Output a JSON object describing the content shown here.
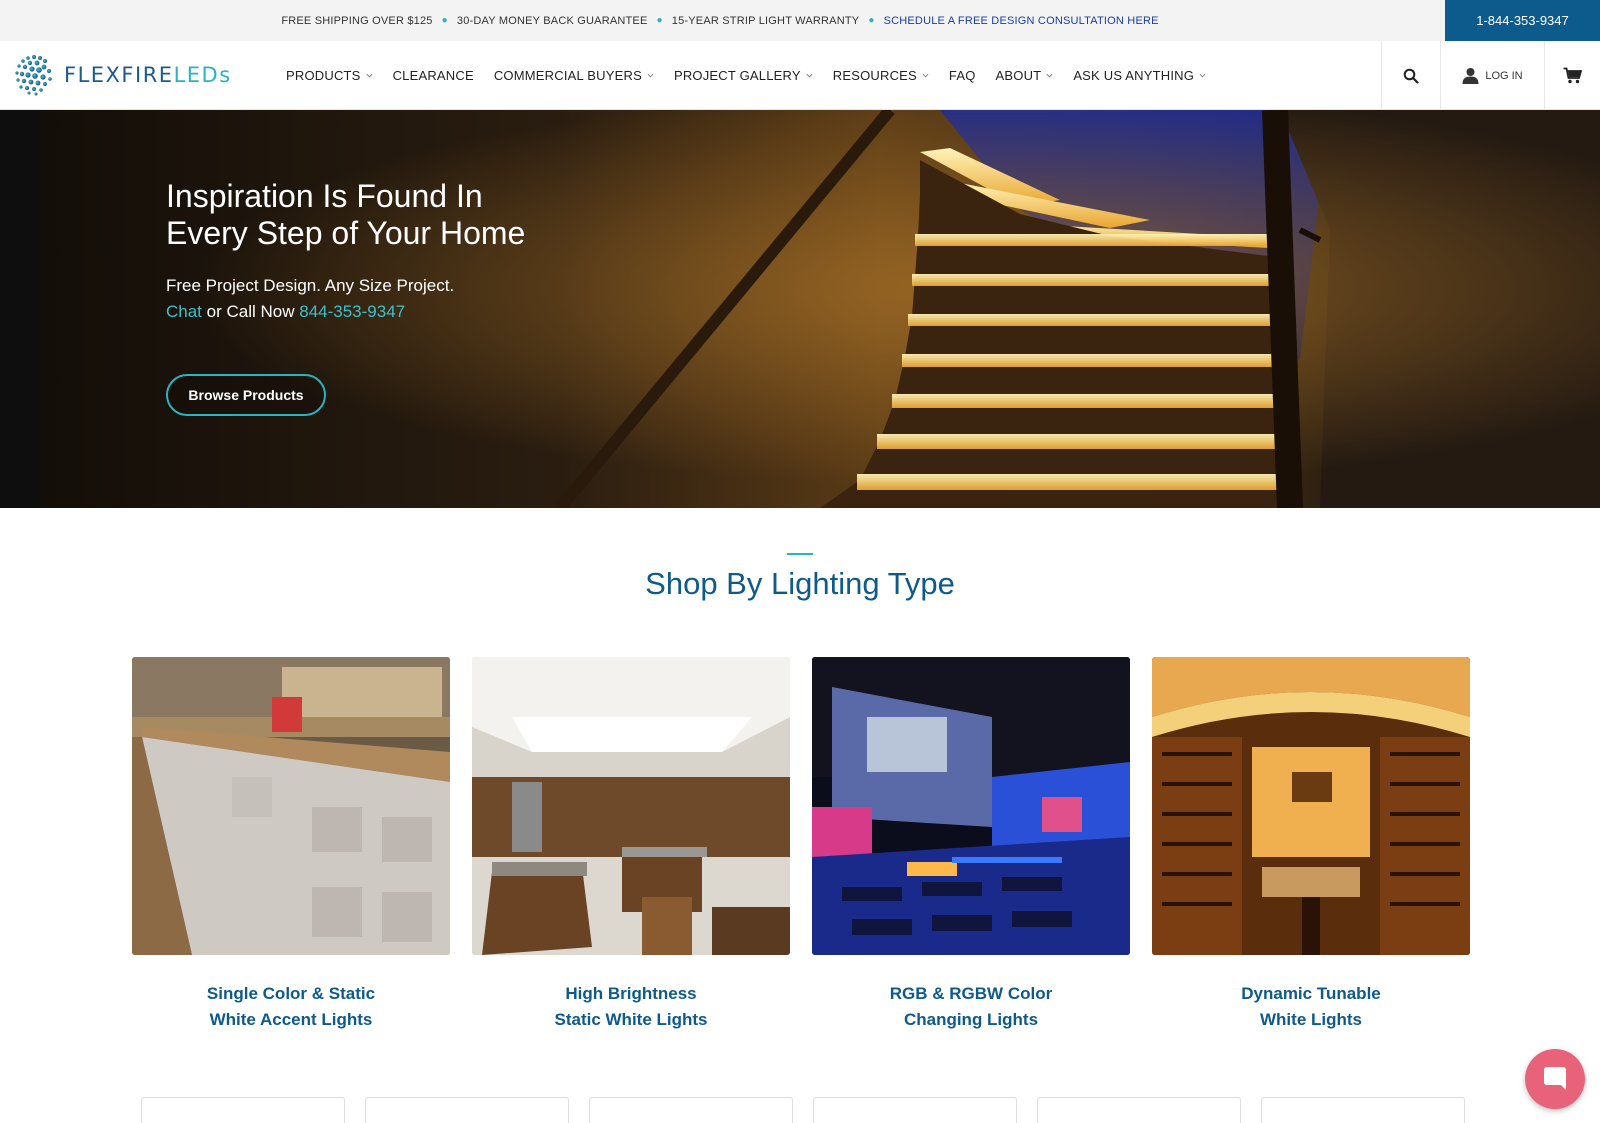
{
  "topbar": {
    "items": [
      "FREE SHIPPING OVER $125",
      "30-DAY MONEY BACK GUARANTEE",
      "15-YEAR STRIP LIGHT WARRANTY"
    ],
    "consult_link": "SCHEDULE A FREE DESIGN CONSULTATION HERE",
    "phone": "1-844-353-9347"
  },
  "header": {
    "logo": {
      "part1": "FLEXFIRE",
      "part2": "LEDs"
    },
    "nav": [
      {
        "label": "PRODUCTS",
        "dropdown": true
      },
      {
        "label": "CLEARANCE",
        "dropdown": false
      },
      {
        "label": "COMMERCIAL BUYERS",
        "dropdown": true
      },
      {
        "label": "PROJECT GALLERY",
        "dropdown": true
      },
      {
        "label": "RESOURCES",
        "dropdown": true
      },
      {
        "label": "FAQ",
        "dropdown": false
      },
      {
        "label": "ABOUT",
        "dropdown": true
      },
      {
        "label": "ASK US ANYTHING",
        "dropdown": true
      }
    ],
    "login_label": "LOG IN",
    "icons": [
      "search-icon",
      "user-icon",
      "cart-icon"
    ]
  },
  "hero": {
    "title_line1": "Inspiration Is Found In",
    "title_line2": "Every Step of Your Home",
    "subtitle": "Free Project Design. Any Size Project.",
    "chat_link": "Chat",
    "call_text": "or Call Now",
    "phone_link": "844-353-9347",
    "button_label": "Browse Products"
  },
  "section": {
    "title": "Shop By Lighting Type"
  },
  "cards": [
    {
      "line1": "Single Color & Static",
      "line2": "White Accent Lights"
    },
    {
      "line1": "High Brightness",
      "line2": "Static White Lights"
    },
    {
      "line1": "RGB & RGBW Color",
      "line2": "Changing Lights"
    },
    {
      "line1": "Dynamic Tunable",
      "line2": "White Lights"
    }
  ],
  "colors": {
    "brand_blue": "#0e5a8a",
    "accent_teal": "#2bb3c0",
    "phone_box": "#0d5a8c",
    "chat_button": "#e8627a"
  }
}
